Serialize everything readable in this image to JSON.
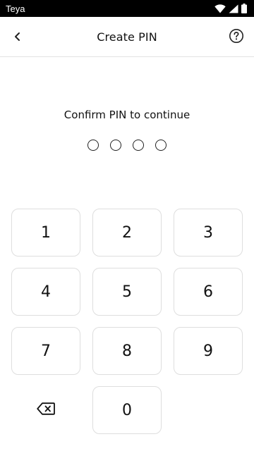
{
  "status_bar": {
    "carrier": "Teya",
    "icons": [
      "wifi-icon",
      "signal-icon",
      "battery-icon"
    ]
  },
  "app_bar": {
    "title": "Create PIN",
    "back_icon": "chevron-left-icon",
    "help_icon": "question-circle-icon"
  },
  "prompt": "Confirm PIN to continue",
  "pin": {
    "length": 4,
    "entered": 0
  },
  "keypad": {
    "keys": [
      "1",
      "2",
      "3",
      "4",
      "5",
      "6",
      "7",
      "8",
      "9",
      "0"
    ],
    "backspace_icon": "backspace-icon"
  }
}
